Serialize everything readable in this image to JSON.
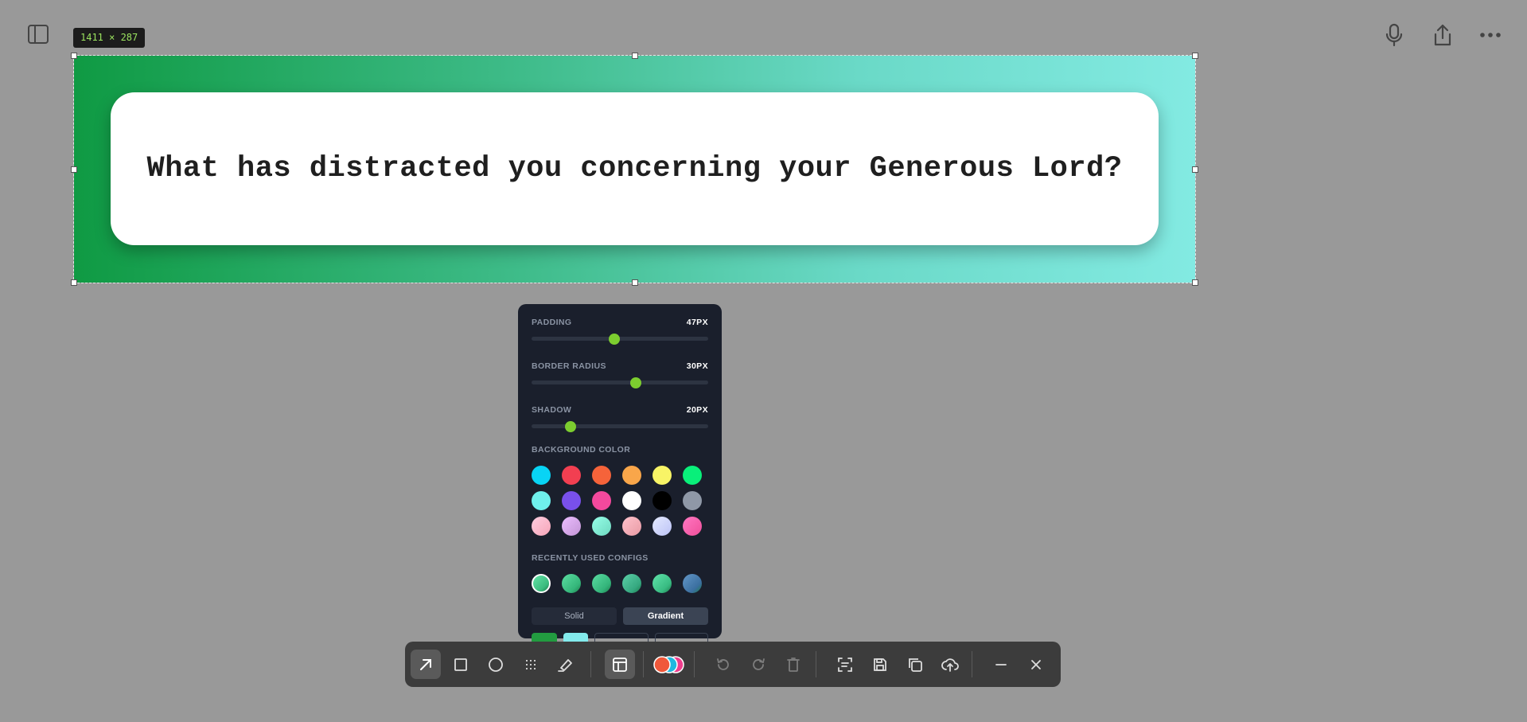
{
  "selection": {
    "dimensions_label": "1411 × 287"
  },
  "canvas": {
    "quote": "What has distracted you concerning your Generous Lord?",
    "gradient_start": "#229B40",
    "gradient_end": "#83EAEC"
  },
  "top_bar": {
    "left_icons": [
      "sidebar-toggle-icon"
    ],
    "right_icons": [
      "microphone-icon",
      "share-icon",
      "more-icon"
    ]
  },
  "panel": {
    "padding": {
      "label": "PADDING",
      "value": "47PX",
      "level": 0.47
    },
    "border_radius": {
      "label": "BORDER RADIUS",
      "value": "30PX",
      "level": 0.59
    },
    "shadow": {
      "label": "SHADOW",
      "value": "20PX",
      "level": 0.22
    },
    "background_color_label": "BACKGROUND COLOR",
    "background_colors": [
      "#08d4f5",
      "#f23f51",
      "#f5633a",
      "#f9a64a",
      "#f8f466",
      "#09ef7a",
      "#6ff0ec",
      "#7950eb",
      "#f4499d",
      "#ffffff",
      "#000000",
      "#8f98a7",
      "#f6a5b8",
      "#c395d6",
      "#6ed8c0",
      "#e89aa4",
      "#bcc2f6",
      "#f04f9a"
    ],
    "background_color_styles": [
      "solid",
      "solid",
      "solid",
      "solid",
      "solid",
      "solid",
      "solid",
      "solid",
      "solid",
      "solid",
      "solid",
      "solid",
      "gradient",
      "gradient",
      "gradient",
      "gradient",
      "gradient",
      "gradient"
    ],
    "recent_label": "RECENTLY USED CONFIGS",
    "recent_configs": [
      "#3bbb7e",
      "#34b67a",
      "#33b47a",
      "#35a880",
      "#38bb82",
      "#3b6fa0"
    ],
    "solid_label": "Solid",
    "gradient_label": "Gradient",
    "mode": "Gradient",
    "color_a_hex": "#229B40",
    "color_b_hex": "#83EAEC"
  },
  "toolbar": {
    "tools": [
      "arrow-icon",
      "rectangle-icon",
      "circle-icon",
      "pixelate-icon",
      "highlighter-icon",
      "layout-icon"
    ],
    "active_tool": "arrow-icon",
    "actions": [
      "undo-icon",
      "redo-icon",
      "trash-icon",
      "ocr-icon",
      "save-icon",
      "copy-icon",
      "upload-icon",
      "minimize-icon",
      "close-icon"
    ]
  }
}
